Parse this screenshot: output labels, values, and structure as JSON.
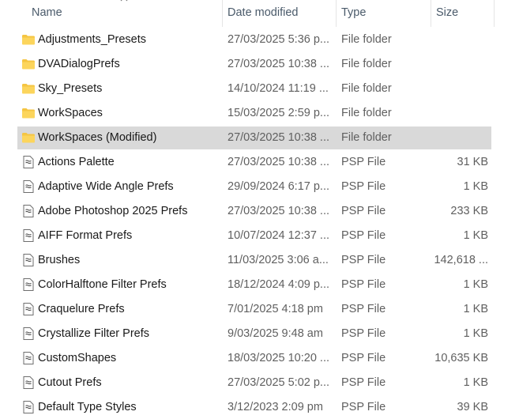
{
  "columns": {
    "name": "Name",
    "date": "Date modified",
    "type": "Type",
    "size": "Size"
  },
  "rows": [
    {
      "name": "Adjustments_Presets",
      "date": "27/03/2025 5:36 p...",
      "type": "File folder",
      "size": "",
      "icon": "folder-icon",
      "selected": false
    },
    {
      "name": "DVADialogPrefs",
      "date": "27/03/2025 10:38 ...",
      "type": "File folder",
      "size": "",
      "icon": "folder-icon",
      "selected": false
    },
    {
      "name": "Sky_Presets",
      "date": "14/10/2024 11:19 ...",
      "type": "File folder",
      "size": "",
      "icon": "folder-icon",
      "selected": false
    },
    {
      "name": "WorkSpaces",
      "date": "15/03/2025 2:59 p...",
      "type": "File folder",
      "size": "",
      "icon": "folder-icon",
      "selected": false
    },
    {
      "name": "WorkSpaces (Modified)",
      "date": "27/03/2025 10:38 ...",
      "type": "File folder",
      "size": "",
      "icon": "folder-icon",
      "selected": true
    },
    {
      "name": "Actions Palette",
      "date": "27/03/2025 10:38 ...",
      "type": "PSP File",
      "size": "31 KB",
      "icon": "file-icon",
      "selected": false
    },
    {
      "name": "Adaptive Wide Angle Prefs",
      "date": "29/09/2024 6:17 p...",
      "type": "PSP File",
      "size": "1 KB",
      "icon": "file-icon",
      "selected": false
    },
    {
      "name": "Adobe Photoshop 2025 Prefs",
      "date": "27/03/2025 10:38 ...",
      "type": "PSP File",
      "size": "233 KB",
      "icon": "file-icon",
      "selected": false
    },
    {
      "name": "AIFF Format Prefs",
      "date": "10/07/2024 12:37 ...",
      "type": "PSP File",
      "size": "1 KB",
      "icon": "file-icon",
      "selected": false
    },
    {
      "name": "Brushes",
      "date": "11/03/2025 3:06 a...",
      "type": "PSP File",
      "size": "142,618 ...",
      "icon": "file-icon",
      "selected": false
    },
    {
      "name": "ColorHalftone Filter Prefs",
      "date": "18/12/2024 4:09 p...",
      "type": "PSP File",
      "size": "1 KB",
      "icon": "file-icon",
      "selected": false
    },
    {
      "name": "Craquelure Prefs",
      "date": "7/01/2025 4:18 pm",
      "type": "PSP File",
      "size": "1 KB",
      "icon": "file-icon",
      "selected": false
    },
    {
      "name": "Crystallize Filter Prefs",
      "date": "9/03/2025 9:48 am",
      "type": "PSP File",
      "size": "1 KB",
      "icon": "file-icon",
      "selected": false
    },
    {
      "name": "CustomShapes",
      "date": "18/03/2025 10:20 ...",
      "type": "PSP File",
      "size": "10,635 KB",
      "icon": "file-icon",
      "selected": false
    },
    {
      "name": "Cutout Prefs",
      "date": "27/03/2025 5:02 p...",
      "type": "PSP File",
      "size": "1 KB",
      "icon": "file-icon",
      "selected": false
    },
    {
      "name": "Default Type Styles",
      "date": "3/12/2023 2:09 pm",
      "type": "PSP File",
      "size": "39 KB",
      "icon": "file-icon",
      "selected": false
    }
  ]
}
